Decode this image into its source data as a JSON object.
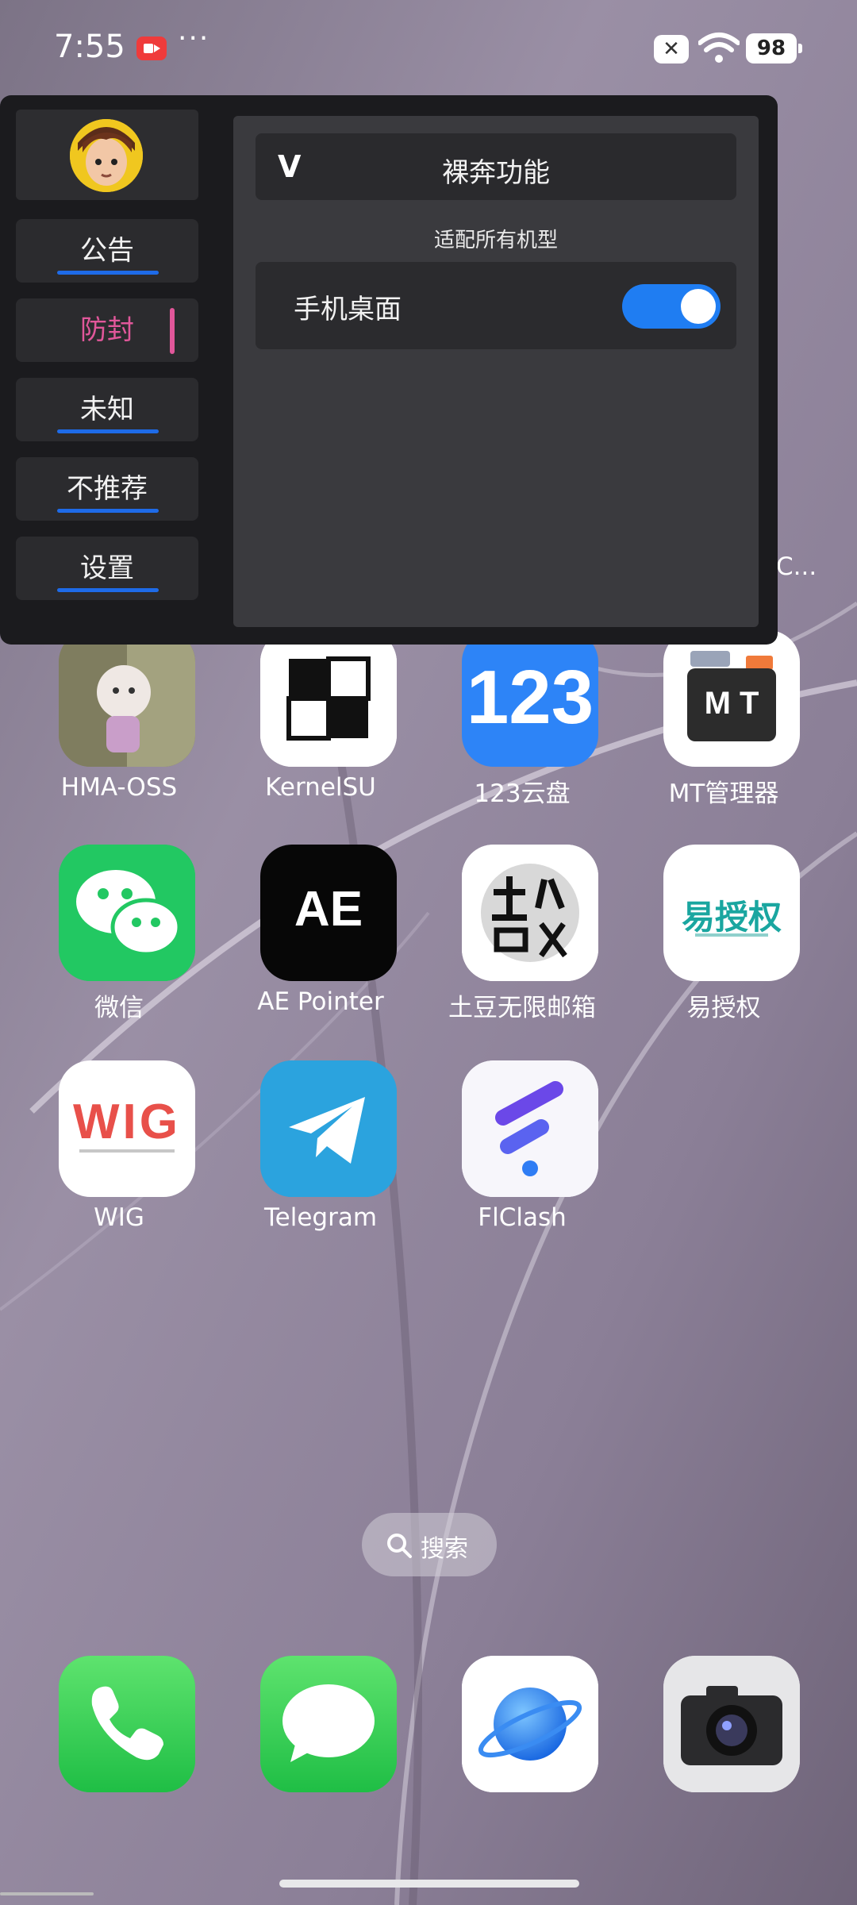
{
  "status_bar": {
    "time": "7:55",
    "more": "···",
    "battery": "98"
  },
  "overlay": {
    "nav": [
      {
        "label": "公告",
        "active": false
      },
      {
        "label": "防封",
        "active": true
      },
      {
        "label": "未知",
        "active": false
      },
      {
        "label": "不推荐",
        "active": false
      },
      {
        "label": "设置",
        "active": false
      }
    ],
    "section_title": "裸奔功能",
    "section_chevron": "V",
    "section_subtitle": "适配所有机型",
    "toggle_label": "手机桌面",
    "toggle_on": true,
    "accent_color": "#1f7df2",
    "active_color": "#e1579a"
  },
  "partial_app_label": "C...",
  "apps": [
    {
      "label": "HMA-OSS",
      "icon": "hma-oss-icon"
    },
    {
      "label": "KernelSU",
      "icon": "kernelsu-icon"
    },
    {
      "label": "123云盘",
      "icon": "123-cloud-icon",
      "icon_text": "123"
    },
    {
      "label": "MT管理器",
      "icon": "mt-manager-icon",
      "icon_text": "M T"
    },
    {
      "label": "微信",
      "icon": "wechat-icon"
    },
    {
      "label": "AE Pointer",
      "icon": "ae-pointer-icon",
      "icon_text": "AE"
    },
    {
      "label": "土豆无限邮箱",
      "icon": "tudou-mail-icon"
    },
    {
      "label": "易授权",
      "icon": "yi-auth-icon",
      "icon_text": "易授权"
    },
    {
      "label": "WIG",
      "icon": "wig-icon",
      "icon_text": "WIG"
    },
    {
      "label": "Telegram",
      "icon": "telegram-icon"
    },
    {
      "label": "FlClash",
      "icon": "flclash-icon"
    }
  ],
  "search": {
    "label": "搜索"
  },
  "dock": [
    {
      "icon": "phone-icon"
    },
    {
      "icon": "messages-icon"
    },
    {
      "icon": "browser-icon"
    },
    {
      "icon": "camera-icon"
    }
  ]
}
